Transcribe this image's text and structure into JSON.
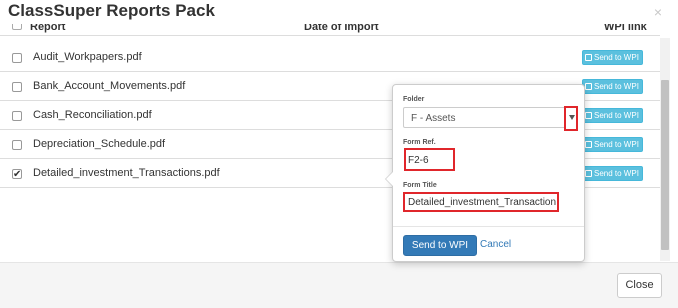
{
  "modal": {
    "title": "ClassSuper Reports Pack",
    "close_glyph": "×",
    "close_button": "Close"
  },
  "table": {
    "headers": {
      "report": "Report",
      "date": "Date of Import",
      "link": "WPI link"
    },
    "rows": [
      {
        "name": "Audit_Workpapers.pdf",
        "checked": false,
        "button": "Send to WPI"
      },
      {
        "name": "Bank_Account_Movements.pdf",
        "checked": false,
        "button": "Send to WPI"
      },
      {
        "name": "Cash_Reconciliation.pdf",
        "checked": false,
        "button": "Send to WPI"
      },
      {
        "name": "Depreciation_Schedule.pdf",
        "checked": false,
        "button": "Send to WPI"
      },
      {
        "name": "Detailed_investment_Transactions.pdf",
        "checked": true,
        "button": "Send to WPI"
      }
    ]
  },
  "popover": {
    "folder_label": "Folder",
    "folder_value": "F - Assets",
    "form_ref_label": "Form Ref.",
    "form_ref_value": "F2-6",
    "form_title_label": "Form Title",
    "form_title_value": "Detailed_investment_Transaction",
    "send_label": "Send to WPI",
    "cancel_label": "Cancel"
  },
  "colors": {
    "info_button": "#5bc0de",
    "primary_button": "#337ab7",
    "highlight_border": "#e0262b"
  },
  "icons": {
    "send_to_wpi": "export-icon",
    "dropdown": "caret-down-icon",
    "close": "close-icon"
  }
}
